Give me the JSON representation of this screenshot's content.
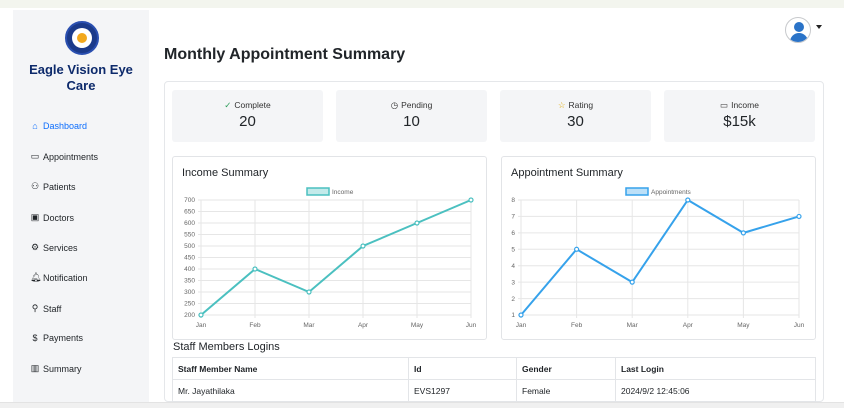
{
  "brand": {
    "name": "Eagle Vision Eye Care"
  },
  "sidebar": {
    "items": [
      {
        "label": "Dashboard",
        "icon": "home-icon",
        "glyph": "⌂",
        "active": true
      },
      {
        "label": "Appointments",
        "icon": "calendar-icon",
        "glyph": "▭"
      },
      {
        "label": "Patients",
        "icon": "people-icon",
        "glyph": "⚇"
      },
      {
        "label": "Doctors",
        "icon": "id-badge-icon",
        "glyph": "▣"
      },
      {
        "label": "Services",
        "icon": "gear-icon",
        "glyph": "⚙"
      },
      {
        "label": "Notification",
        "icon": "bell-icon",
        "glyph": "🔔︎"
      },
      {
        "label": "Staff",
        "icon": "person-icon",
        "glyph": "⚲"
      },
      {
        "label": "Payments",
        "icon": "dollar-icon",
        "glyph": "$"
      },
      {
        "label": "Summary",
        "icon": "bar-chart-icon",
        "glyph": "▥"
      }
    ]
  },
  "header": {
    "title": "Monthly Appointment Summary",
    "user_icon": "user-avatar-icon"
  },
  "stats": [
    {
      "label": "Complete",
      "value": "20",
      "icon": "check-circle-icon",
      "glyph": "✓",
      "color": "#2e9e5b"
    },
    {
      "label": "Pending",
      "value": "10",
      "icon": "clock-icon",
      "glyph": "◷",
      "color": "#333333"
    },
    {
      "label": "Rating",
      "value": "30",
      "icon": "star-icon",
      "glyph": "☆",
      "color": "#e0a800"
    },
    {
      "label": "Income",
      "value": "$15k",
      "icon": "cash-icon",
      "glyph": "▭",
      "color": "#333333"
    }
  ],
  "chart_data": [
    {
      "type": "line",
      "title": "Income Summary",
      "categories": [
        "Jan",
        "Feb",
        "Mar",
        "Apr",
        "May",
        "Jun"
      ],
      "series": [
        {
          "name": "Income",
          "values": [
            200,
            400,
            300,
            500,
            600,
            700
          ]
        }
      ],
      "ylim": [
        200,
        700
      ],
      "yticks": [
        "700",
        "650",
        "600",
        "550",
        "500",
        "450",
        "400",
        "350",
        "300",
        "250",
        "200"
      ],
      "grid": true,
      "legend": "top-center",
      "color": "#4bc0c0"
    },
    {
      "type": "line",
      "title": "Appointment Summary",
      "categories": [
        "Jan",
        "Feb",
        "Mar",
        "Apr",
        "May",
        "Jun"
      ],
      "series": [
        {
          "name": "Appointments",
          "values": [
            1,
            5,
            3,
            8,
            6,
            7
          ]
        }
      ],
      "ylim": [
        1,
        8
      ],
      "yticks": [
        "8",
        "7",
        "6",
        "5",
        "4",
        "3",
        "2",
        "1"
      ],
      "grid": true,
      "legend": "top-center",
      "color": "#36a2eb"
    }
  ],
  "staff_table": {
    "title": "Staff Members Logins",
    "columns": [
      "Staff Member Name",
      "Id",
      "Gender",
      "Last Login"
    ],
    "rows": [
      [
        "Mr. Jayathilaka",
        "EVS1297",
        "Female",
        "2024/9/2 12:45:06"
      ]
    ]
  }
}
